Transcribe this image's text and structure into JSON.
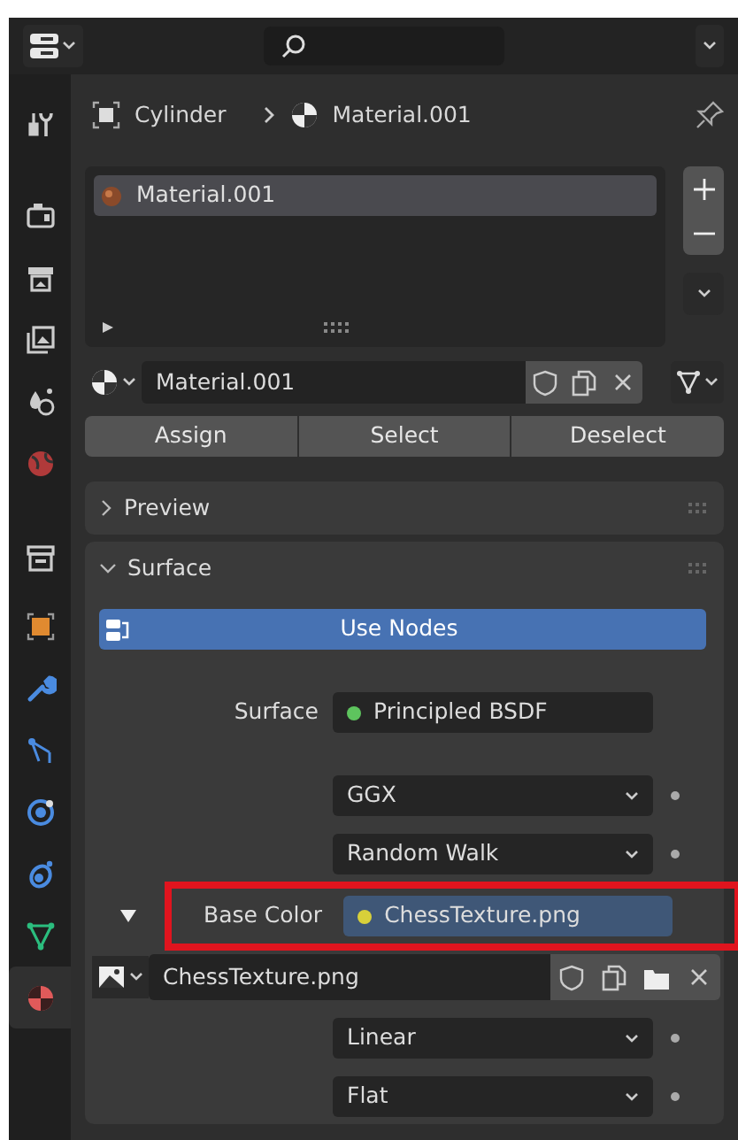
{
  "sidebar": {
    "groups": [
      [
        {
          "kind": "tool",
          "selected": false
        }
      ],
      [
        {
          "kind": "render",
          "selected": false
        },
        {
          "kind": "output",
          "selected": false
        },
        {
          "kind": "view_layer",
          "selected": false
        },
        {
          "kind": "scene",
          "selected": false
        },
        {
          "kind": "world",
          "selected": false
        }
      ],
      [
        {
          "kind": "collection",
          "selected": false
        }
      ],
      [
        {
          "kind": "object",
          "selected": false
        },
        {
          "kind": "modifier",
          "selected": false
        },
        {
          "kind": "particles",
          "selected": false
        },
        {
          "kind": "physics",
          "selected": false
        },
        {
          "kind": "constraints",
          "selected": false
        },
        {
          "kind": "data",
          "selected": false
        },
        {
          "kind": "material",
          "selected": true
        }
      ]
    ]
  },
  "breadcrumb": {
    "object": "Cylinder",
    "material": "Material.001"
  },
  "material_slots": [
    {
      "name": "Material.001",
      "selected": true
    }
  ],
  "material_selector": {
    "name": "Material.001"
  },
  "buttons": [
    "Assign",
    "Select",
    "Deselect"
  ],
  "panels": [
    {
      "title": "Preview",
      "expanded": false
    },
    {
      "title": "Surface",
      "expanded": true,
      "use_nodes": "Use Nodes",
      "rows": [
        {
          "kind": "socket",
          "label": "Surface",
          "value": "Principled BSDF",
          "color": "#5ec45e",
          "highlighted": false
        },
        {
          "kind": "dropdown",
          "value": "GGX"
        },
        {
          "kind": "dropdown",
          "value": "Random Walk"
        },
        {
          "kind": "socket",
          "label": "Base Color",
          "value": "ChessTexture.png",
          "color": "#d8d03a",
          "highlighted": true,
          "expanded": true
        },
        {
          "kind": "image",
          "value": "ChessTexture.png"
        },
        {
          "kind": "dropdown",
          "value": "Linear"
        },
        {
          "kind": "dropdown",
          "value": "Flat"
        }
      ]
    }
  ]
}
